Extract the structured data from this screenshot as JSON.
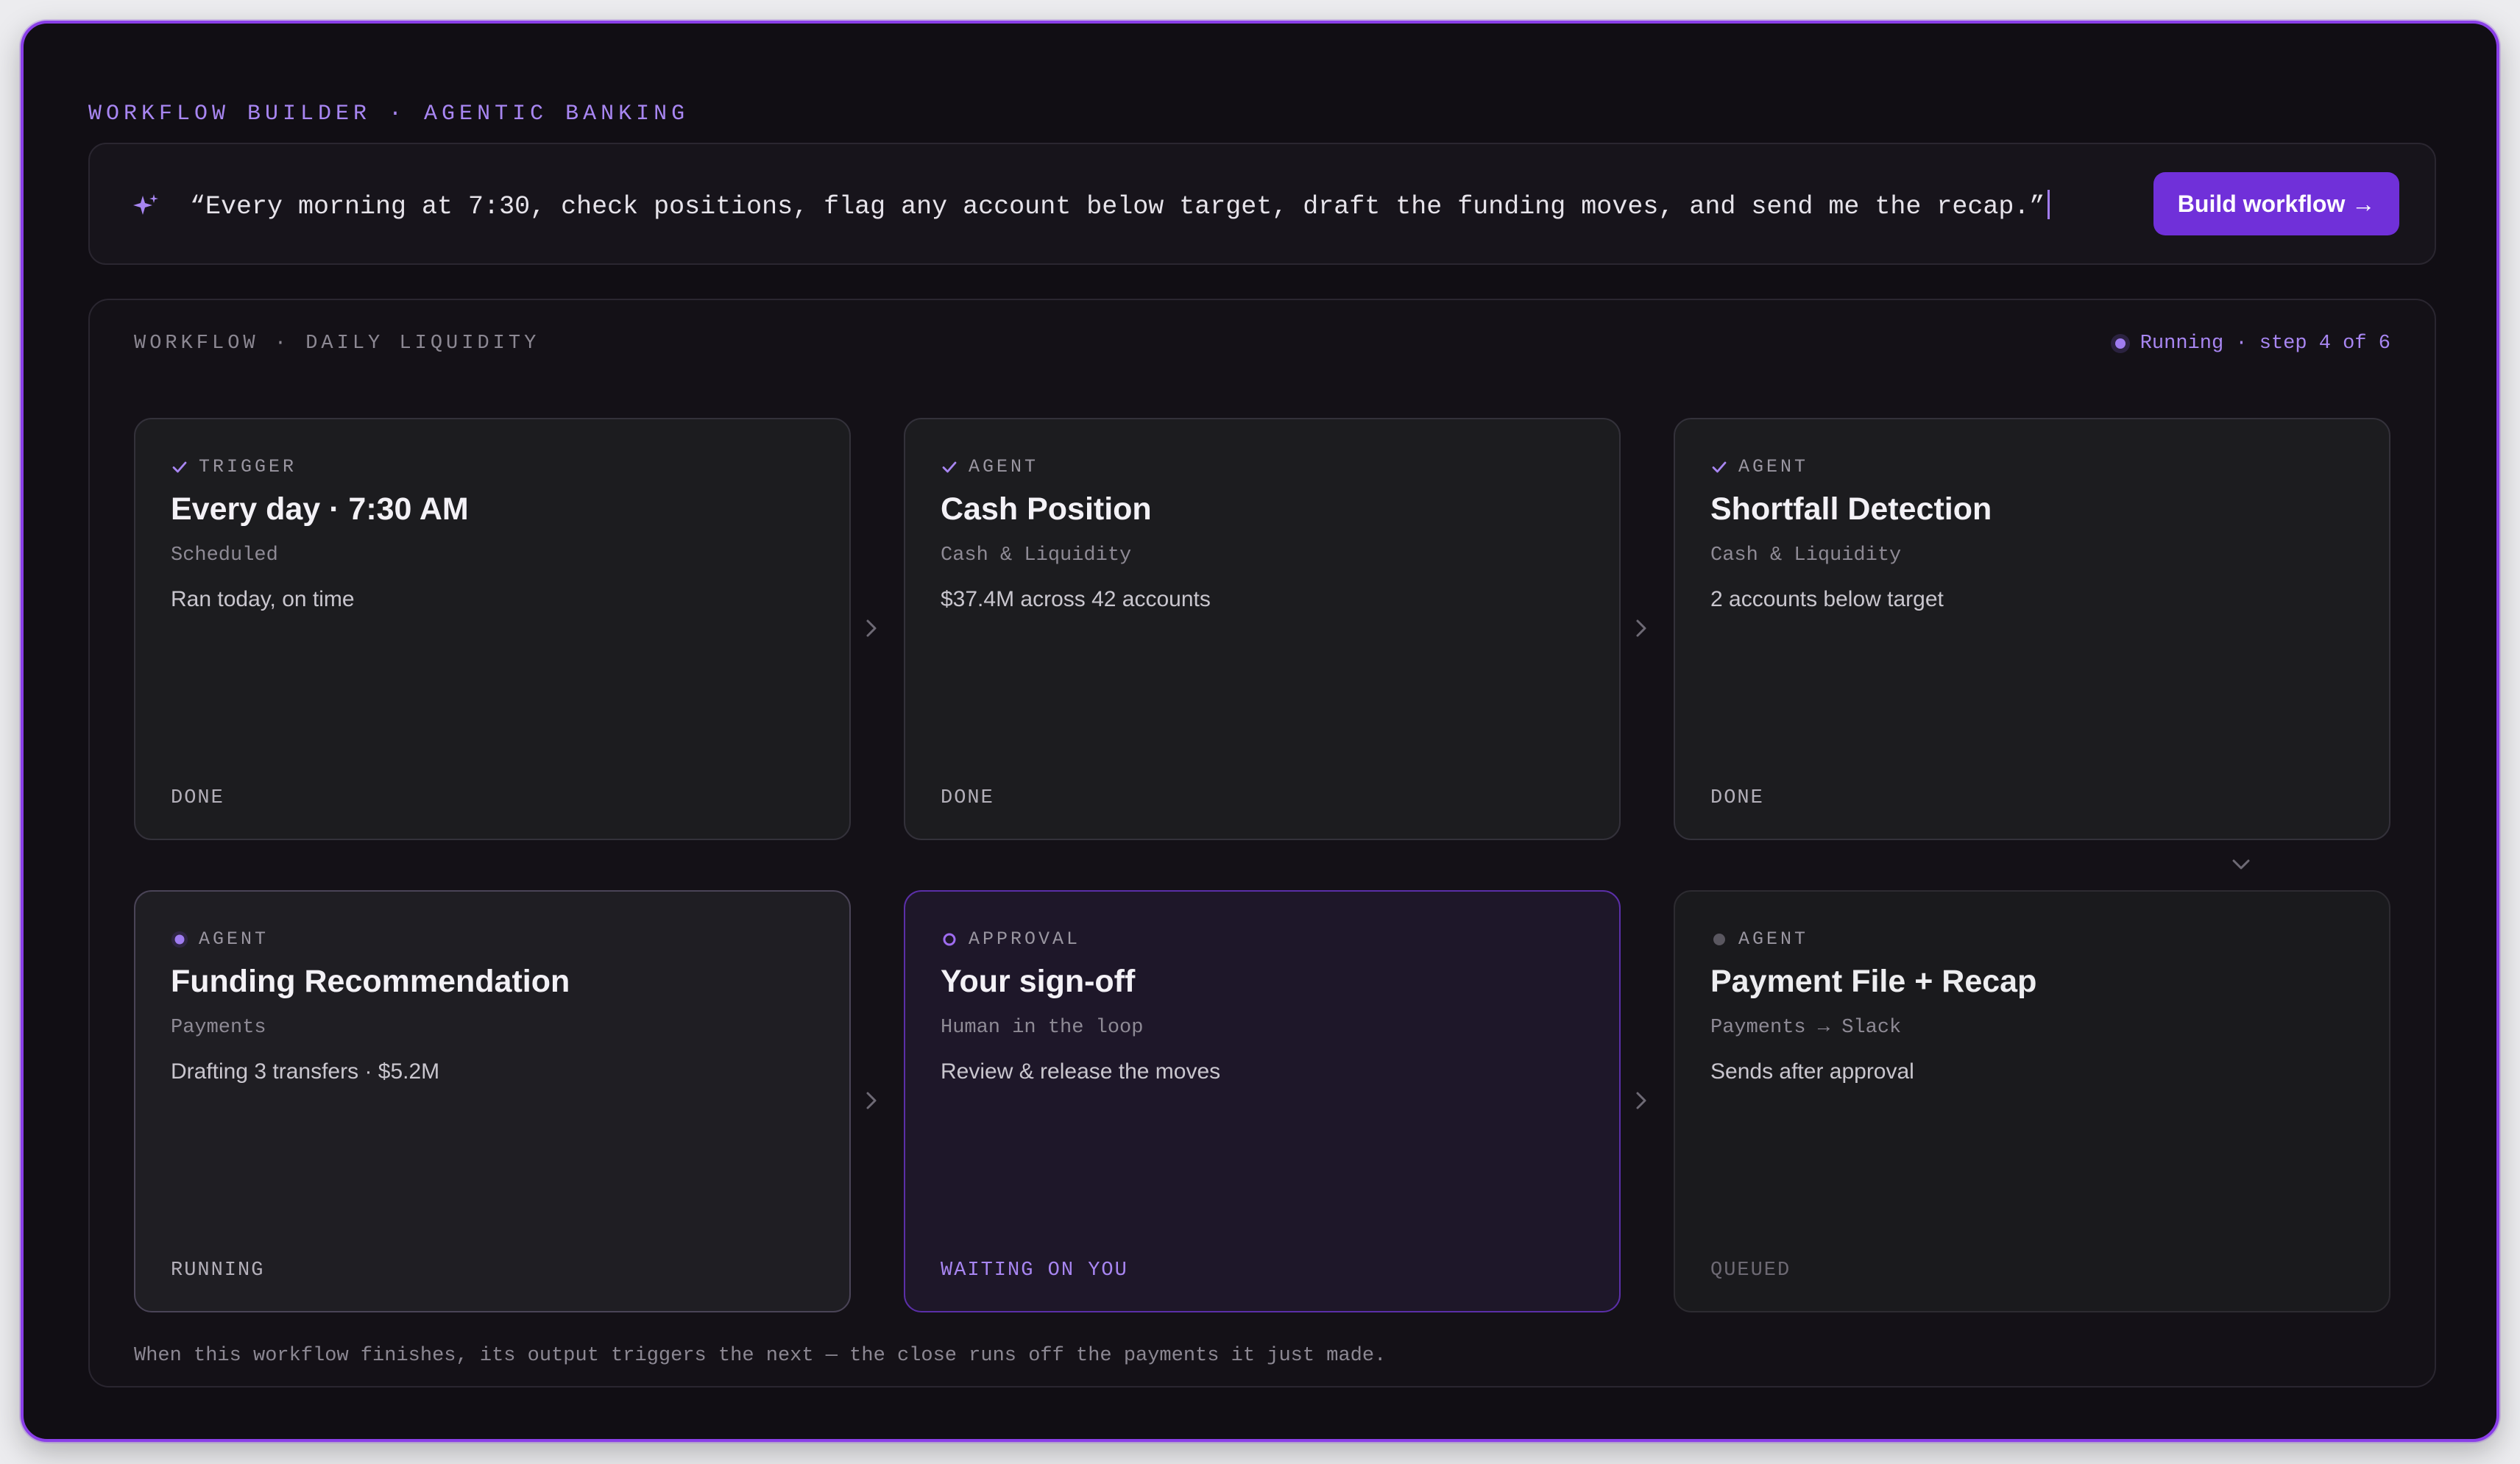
{
  "app": {
    "title": "WORKFLOW BUILDER · AGENTIC BANKING"
  },
  "prompt": {
    "icon": "sparkle-icon",
    "text": "“Every morning at 7:30, check positions, flag any account below target, draft the funding moves, and send me the recap.”",
    "button_label": "Build workflow →"
  },
  "workflow": {
    "title": "WORKFLOW · DAILY LIQUIDITY",
    "status": "Running · step 4 of 6",
    "accent": "#a886f2",
    "steps": [
      {
        "kind": "TRIGGER",
        "title": "Every day · 7:30 AM",
        "subtitle": "Scheduled",
        "detail": "Ran today, on time",
        "state": "DONE",
        "icon": "check-icon"
      },
      {
        "kind": "AGENT",
        "title": "Cash Position",
        "subtitle": "Cash & Liquidity",
        "detail": "$37.4M across 42 accounts",
        "state": "DONE",
        "icon": "check-icon"
      },
      {
        "kind": "AGENT",
        "title": "Shortfall Detection",
        "subtitle": "Cash & Liquidity",
        "detail": "2 accounts below target",
        "state": "DONE",
        "icon": "check-icon"
      },
      {
        "kind": "AGENT",
        "title": "Funding Recommendation",
        "subtitle": "Payments",
        "detail": "Drafting 3 transfers · $5.2M",
        "state": "RUNNING",
        "icon": "running-dot-icon"
      },
      {
        "kind": "APPROVAL",
        "title": "Your sign-off",
        "subtitle": "Human in the loop",
        "detail": "Review & release the moves",
        "state": "WAITING ON YOU",
        "icon": "pending-ring-icon"
      },
      {
        "kind": "AGENT",
        "title": "Payment File + Recap",
        "subtitle": "Payments → Slack",
        "detail": "Sends after approval",
        "state": "QUEUED",
        "icon": "queued-dot-icon"
      }
    ],
    "footer": "When this workflow finishes, its output triggers the next — the close runs off the payments it just made."
  }
}
